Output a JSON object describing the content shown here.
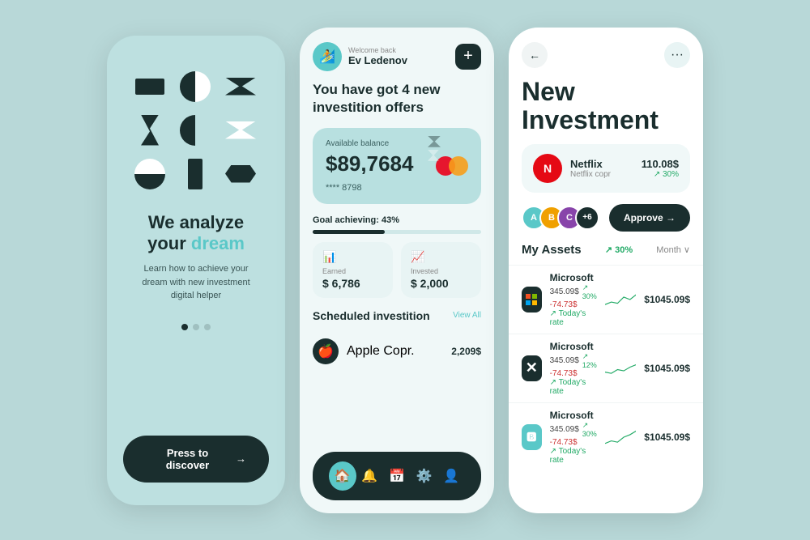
{
  "screen1": {
    "title_line1": "We analyze",
    "title_line2": "your ",
    "title_highlight": "dream",
    "subtitle": "Learn how to achieve your dream with new investment digital helper",
    "discover_btn": "Press to discover",
    "dots": [
      true,
      false,
      false
    ]
  },
  "screen2": {
    "header": {
      "welcome": "Welcome back",
      "name": "Ev Ledenov",
      "plus": "+"
    },
    "headline": "You have got ",
    "headline_bold": "4 new investition offers",
    "balance": {
      "label": "Available balance",
      "amount": "$89,7684",
      "card_number": "**** 8798"
    },
    "goal": {
      "label": "Goal achieving: 43%",
      "percent": 43
    },
    "stats": [
      {
        "label": "Earned",
        "value": "$ 6,786",
        "icon": "📊"
      },
      {
        "label": "Invested",
        "value": "$ 2,000",
        "icon": "📈"
      }
    ],
    "scheduled": {
      "title": "Scheduled investition",
      "view_all": "View All",
      "items": [
        {
          "name": "Apple Copr.",
          "amount": "2,209$",
          "logo": "🍎"
        }
      ]
    },
    "nav": [
      "🏠",
      "🔔",
      "📅",
      "⚙️",
      "👤"
    ]
  },
  "screen3": {
    "back": "←",
    "more": "···",
    "title_line1": "New",
    "title_line2": "Investment",
    "investment": {
      "name": "Netflix",
      "sub": "Netflix copr",
      "amount": "110.08$",
      "change": "↗ 30%",
      "logo": "N"
    },
    "investors_count": "+6",
    "approve_btn": "Approve →",
    "assets": {
      "title": "My Assets",
      "change": "↗ 30%",
      "period": "Month ∨",
      "items": [
        {
          "name": "Microsoft",
          "val": "345.09$",
          "change_pct": "↗ 30%",
          "neg": "-74.73$",
          "rate": "↗ Today's rate",
          "price": "$1045.09$"
        },
        {
          "name": "Microsoft",
          "val": "345.09$",
          "change_pct": "↗ 12%",
          "neg": "-74.73$",
          "rate": "↗ Today's rate",
          "price": "$1045.09$"
        },
        {
          "name": "Microsoft",
          "val": "345.09$",
          "change_pct": "↗ 30%",
          "neg": "-74.73$",
          "rate": "↗ Today's rate",
          "price": "$1045.09$"
        }
      ]
    }
  },
  "colors": {
    "teal": "#5ac8c8",
    "dark": "#1a2e2e",
    "bg_light": "#bde0e0",
    "white": "#ffffff"
  }
}
